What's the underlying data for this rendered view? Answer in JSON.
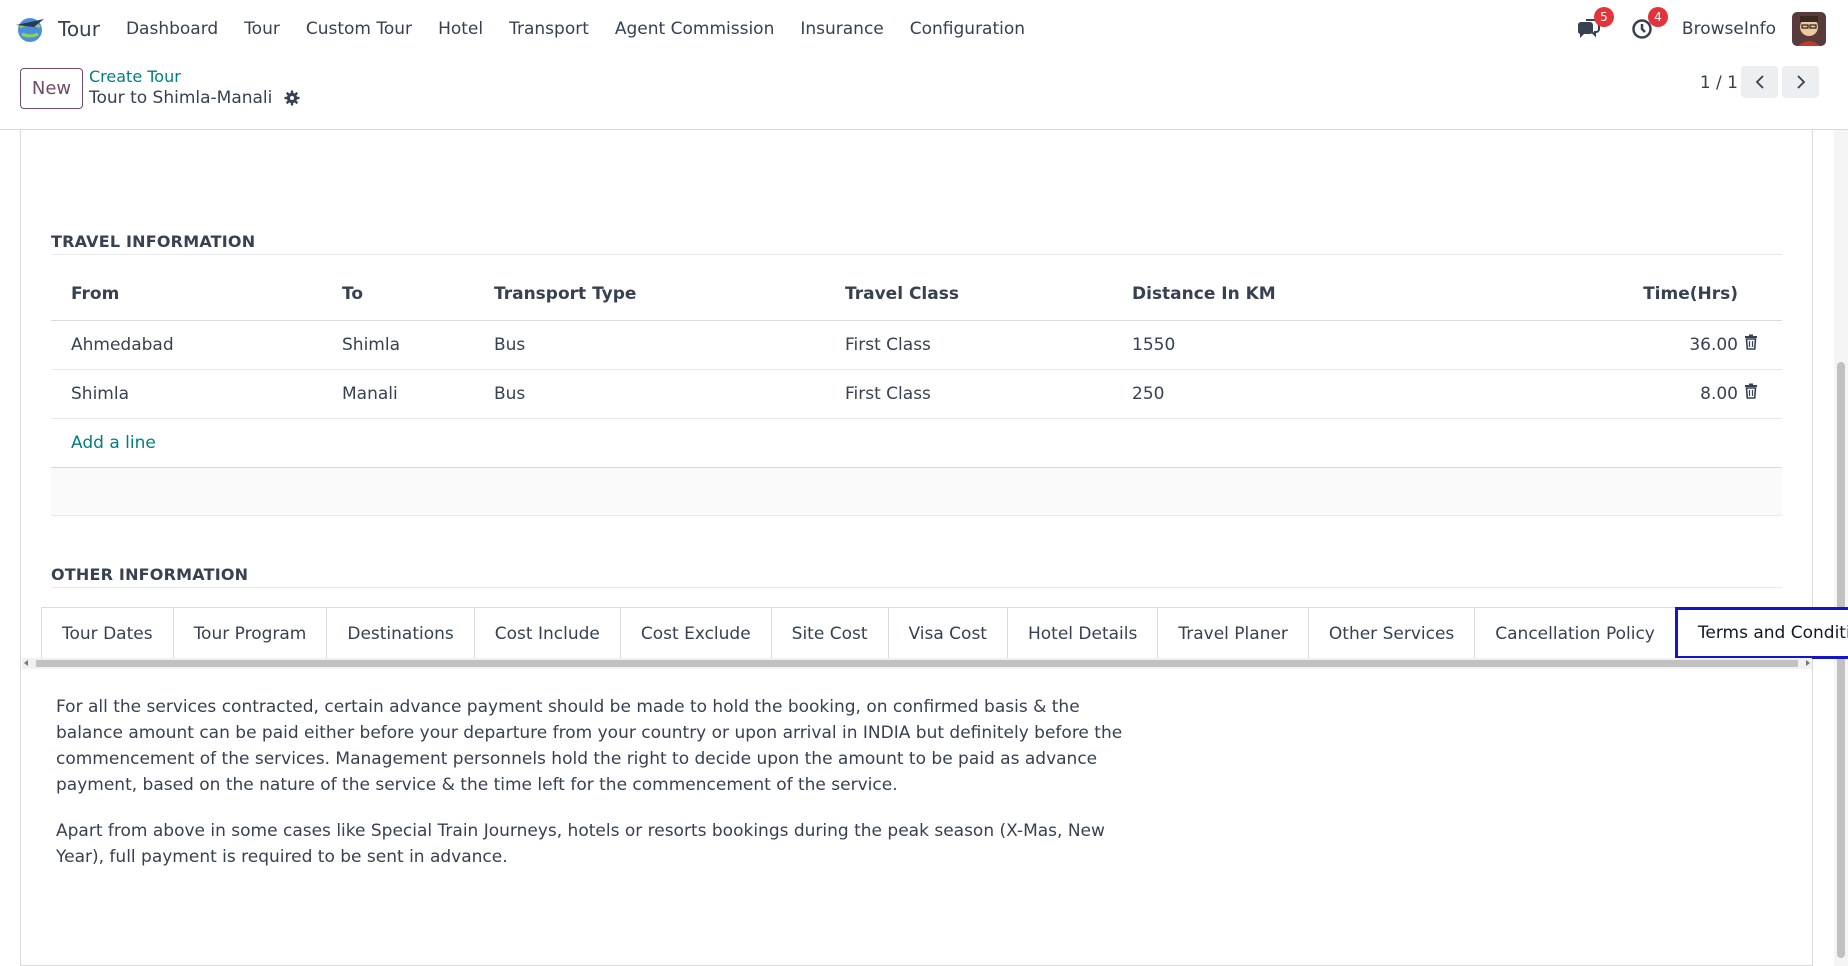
{
  "nav": {
    "app_name": "Tour",
    "menu": [
      "Dashboard",
      "Tour",
      "Custom Tour",
      "Hotel",
      "Transport",
      "Agent Commission",
      "Insurance",
      "Configuration"
    ],
    "messages_count": "5",
    "activities_count": "4",
    "company": "BrowseInfo"
  },
  "control": {
    "new_label": "New",
    "breadcrumb_parent": "Create Tour",
    "breadcrumb_current": "Tour to Shimla-Manali",
    "pager": "1 / 1"
  },
  "travel": {
    "title": "TRAVEL INFORMATION",
    "columns": [
      "From",
      "To",
      "Transport Type",
      "Travel Class",
      "Distance In KM",
      "Time(Hrs)"
    ],
    "rows": [
      [
        "Ahmedabad",
        "Shimla",
        "Bus",
        "First Class",
        "1550",
        "36.00"
      ],
      [
        "Shimla",
        "Manali",
        "Bus",
        "First Class",
        "250",
        "8.00"
      ]
    ],
    "add_line": "Add a line"
  },
  "other": {
    "title": "OTHER INFORMATION",
    "tabs": [
      "Tour Dates",
      "Tour Program",
      "Destinations",
      "Cost Include",
      "Cost Exclude",
      "Site Cost",
      "Visa Cost",
      "Hotel Details",
      "Travel Planer",
      "Other Services",
      "Cancellation Policy",
      "Terms and Conditions"
    ],
    "active_tab": "Terms and Conditions",
    "terms_paragraphs": [
      "For all the services contracted, certain advance payment should be made to hold the booking, on confirmed basis & the balance amount can be paid either before your departure from your country or upon arrival in INDIA but definitely before the commencement of the services. Management personnels hold the right to decide upon the amount to be paid as advance payment, based on the nature of the service & the time left for the commencement of the service.",
      "Apart from above in some cases like Special Train Journeys, hotels or resorts bookings during the peak season (X-Mas, New Year), full payment is required to be sent in advance."
    ]
  },
  "colors": {
    "brand": "#714b67",
    "link": "#017e84",
    "badge": "#e2343a",
    "active_tab_border": "#1515c8"
  }
}
